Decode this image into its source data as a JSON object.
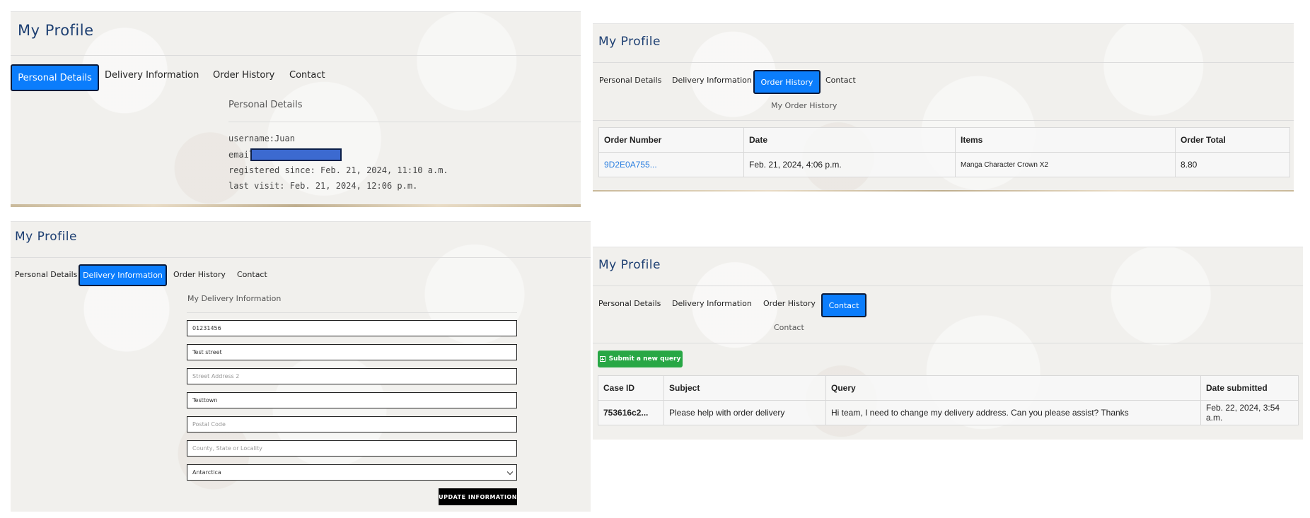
{
  "title": "My Profile",
  "tabs": {
    "personal": "Personal Details",
    "delivery": "Delivery Information",
    "orders": "Order History",
    "contact": "Contact"
  },
  "personal_panel": {
    "heading": "Personal Details",
    "username": "username:Juan",
    "email_label": "email:",
    "registered": "registered since: Feb. 21, 2024, 11:10 a.m.",
    "last_visit": "last visit: Feb. 21, 2024, 12:06 p.m."
  },
  "orders_panel": {
    "heading": "My Order History",
    "columns": [
      "Order Number",
      "Date",
      "Items",
      "Order Total"
    ],
    "rows": [
      {
        "order_number": "9D2E0A755...",
        "date": "Feb. 21, 2024, 4:06 p.m.",
        "items": "Manga Character Crown X2",
        "total": "8.80"
      }
    ]
  },
  "delivery_panel": {
    "heading": "My Delivery Information",
    "phone": "01231456",
    "street1": "Test street",
    "street2_placeholder": "Street Address 2",
    "town": "Testtown",
    "postcode_placeholder": "Postal Code",
    "county_placeholder": "County, State or Locality",
    "country": "Antarctica",
    "update_button": "UPDATE INFORMATION"
  },
  "contact_panel": {
    "heading": "Contact",
    "new_query_button": "Submit a new query",
    "columns": [
      "Case ID",
      "Subject",
      "Query",
      "Date submitted"
    ],
    "rows": [
      {
        "case_id": "753616c2...",
        "subject": "Please help with order delivery",
        "query": "Hi team, I need to change my delivery address. Can you please assist? Thanks",
        "date": "Feb. 22, 2024, 3:54 a.m."
      }
    ]
  },
  "colors": {
    "accent": "#0b7dfc",
    "title": "#1d3f72",
    "success": "#28a745",
    "link": "#2b7fe0",
    "redaction": "#3c6ad0"
  }
}
